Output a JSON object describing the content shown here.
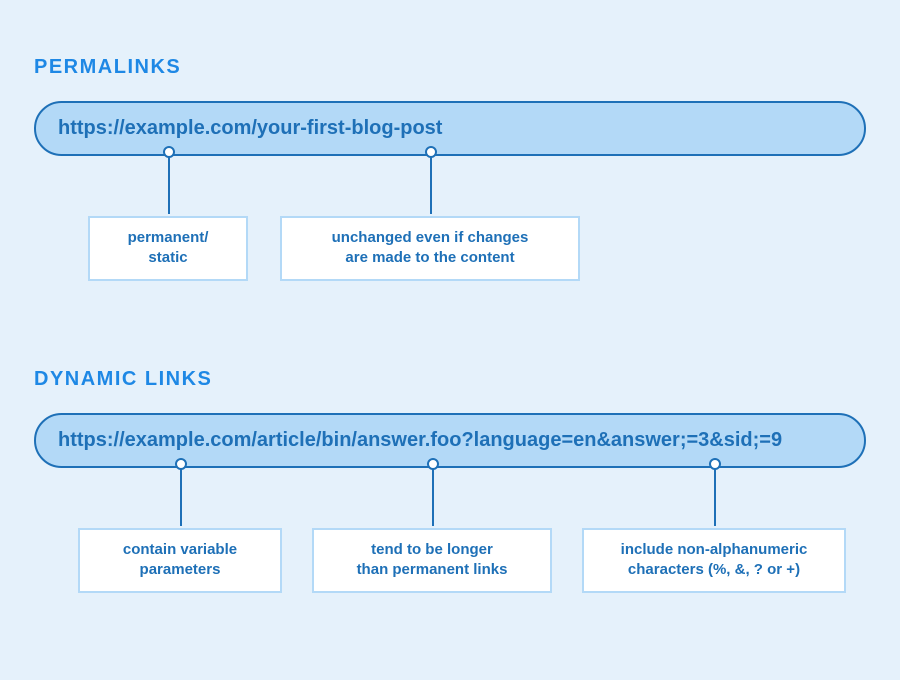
{
  "sections": {
    "permalinks": {
      "title": "PERMALINKS",
      "url": "https://example.com/your-first-blog-post",
      "annotations": [
        "permanent/\nstatic",
        "unchanged even if changes\nare made to the content"
      ]
    },
    "dynamic": {
      "title": "DYNAMIC LINKS",
      "url": "https://example.com/article/bin/answer.foo?language=en&answer;=3&sid;=9",
      "annotations": [
        "contain variable\nparameters",
        "tend to be longer\nthan permanent links",
        "include non-alphanumeric\ncharacters (%, &, ? or +)"
      ]
    }
  }
}
